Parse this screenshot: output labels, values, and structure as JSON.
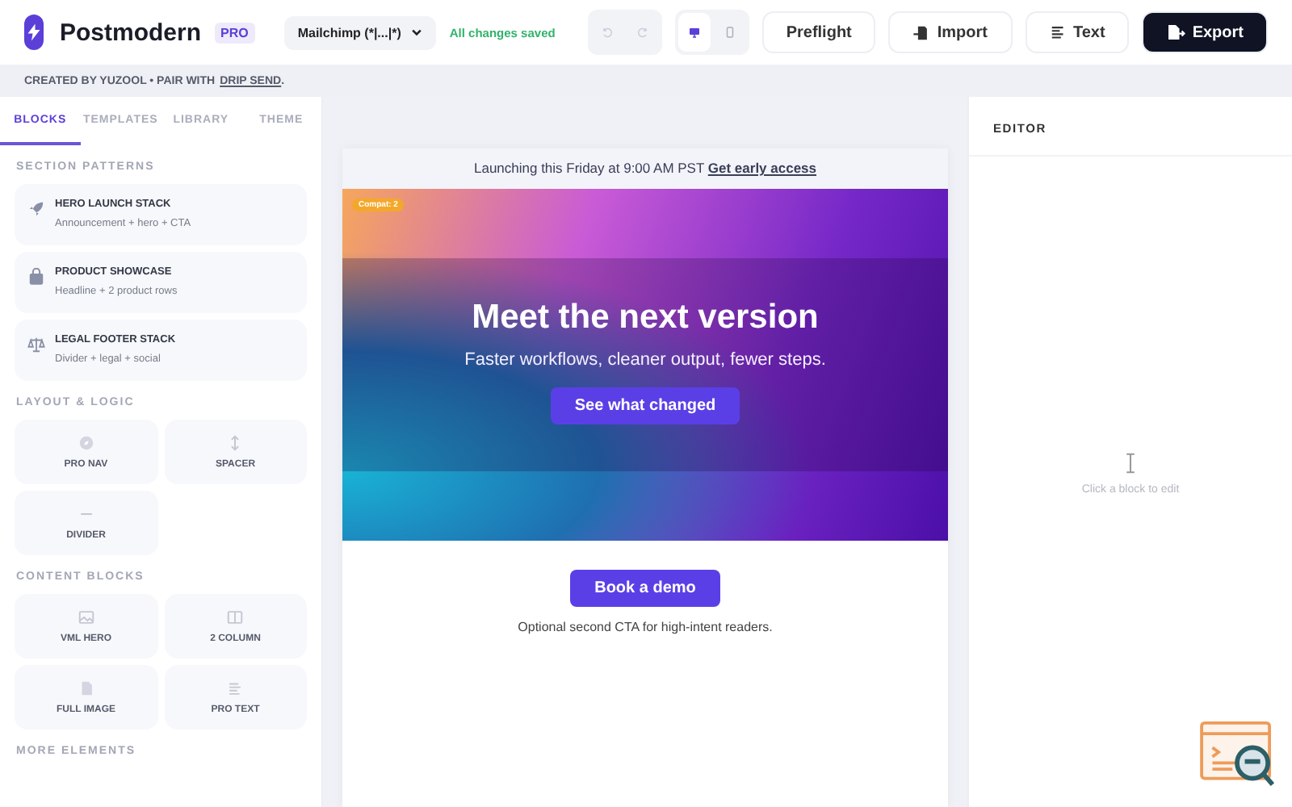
{
  "header": {
    "app_name": "Postmodern",
    "plan_badge": "PRO",
    "esp_select": "Mailchimp (*|...|*)",
    "save_status": "All changes saved",
    "view_modes": [
      {
        "kind": "desktop",
        "selected": true
      },
      {
        "kind": "mobile",
        "selected": false
      }
    ],
    "buttons": [
      {
        "kind": "plain",
        "label": "Preflight"
      },
      {
        "kind": "import",
        "label": "Import"
      },
      {
        "kind": "text",
        "label": "Text"
      },
      {
        "kind": "export",
        "label": "Export"
      }
    ]
  },
  "credit_bar": {
    "text": "CREATED BY YUZOOL • PAIR WITH",
    "link": "DRIP SEND",
    "suffix": "."
  },
  "sidebar": {
    "tabs": [
      {
        "label": "BLOCKS",
        "selected": true
      },
      {
        "label": "TEMPLATES",
        "selected": false
      },
      {
        "label": "LIBRARY",
        "selected": false
      },
      {
        "label": "THEME",
        "selected": false
      }
    ],
    "sections": [
      {
        "title": "SECTION PATTERNS",
        "kind": "patterns",
        "items": [
          {
            "kind": "rocket",
            "title": "HERO LAUNCH STACK",
            "subtitle": "Announcement + hero + CTA"
          },
          {
            "kind": "bag",
            "title": "PRODUCT SHOWCASE",
            "subtitle": "Headline + 2 product rows"
          },
          {
            "kind": "scale",
            "title": "LEGAL FOOTER STACK",
            "subtitle": "Divider + legal + social"
          }
        ]
      },
      {
        "title": "LAYOUT & LOGIC",
        "kind": "grid",
        "items": [
          {
            "kind": "compass",
            "title": "PRO NAV"
          },
          {
            "kind": "updown",
            "title": "SPACER"
          },
          {
            "kind": "line",
            "title": "DIVIDER"
          }
        ]
      },
      {
        "title": "CONTENT BLOCKS",
        "kind": "grid",
        "items": [
          {
            "kind": "image",
            "title": "VML HERO"
          },
          {
            "kind": "columns",
            "title": "2 COLUMN"
          },
          {
            "kind": "file",
            "title": "FULL IMAGE"
          },
          {
            "kind": "lines",
            "title": "PRO TEXT"
          }
        ]
      },
      {
        "title": "MORE ELEMENTS",
        "kind": "grid"
      }
    ]
  },
  "canvas": {
    "announcement": {
      "text": "Launching this Friday at 9:00 AM PST",
      "link": "Get early access"
    },
    "hero": {
      "badge": "Compat: 2",
      "heading": "Meet the next version",
      "subheading": "Faster workflows, cleaner output, fewer steps.",
      "button": "See what changed"
    },
    "cta": {
      "button": "Book a demo",
      "note": "Optional second CTA for high-intent readers."
    }
  },
  "editor": {
    "title": "EDITOR",
    "empty_text": "Click a block to edit"
  }
}
